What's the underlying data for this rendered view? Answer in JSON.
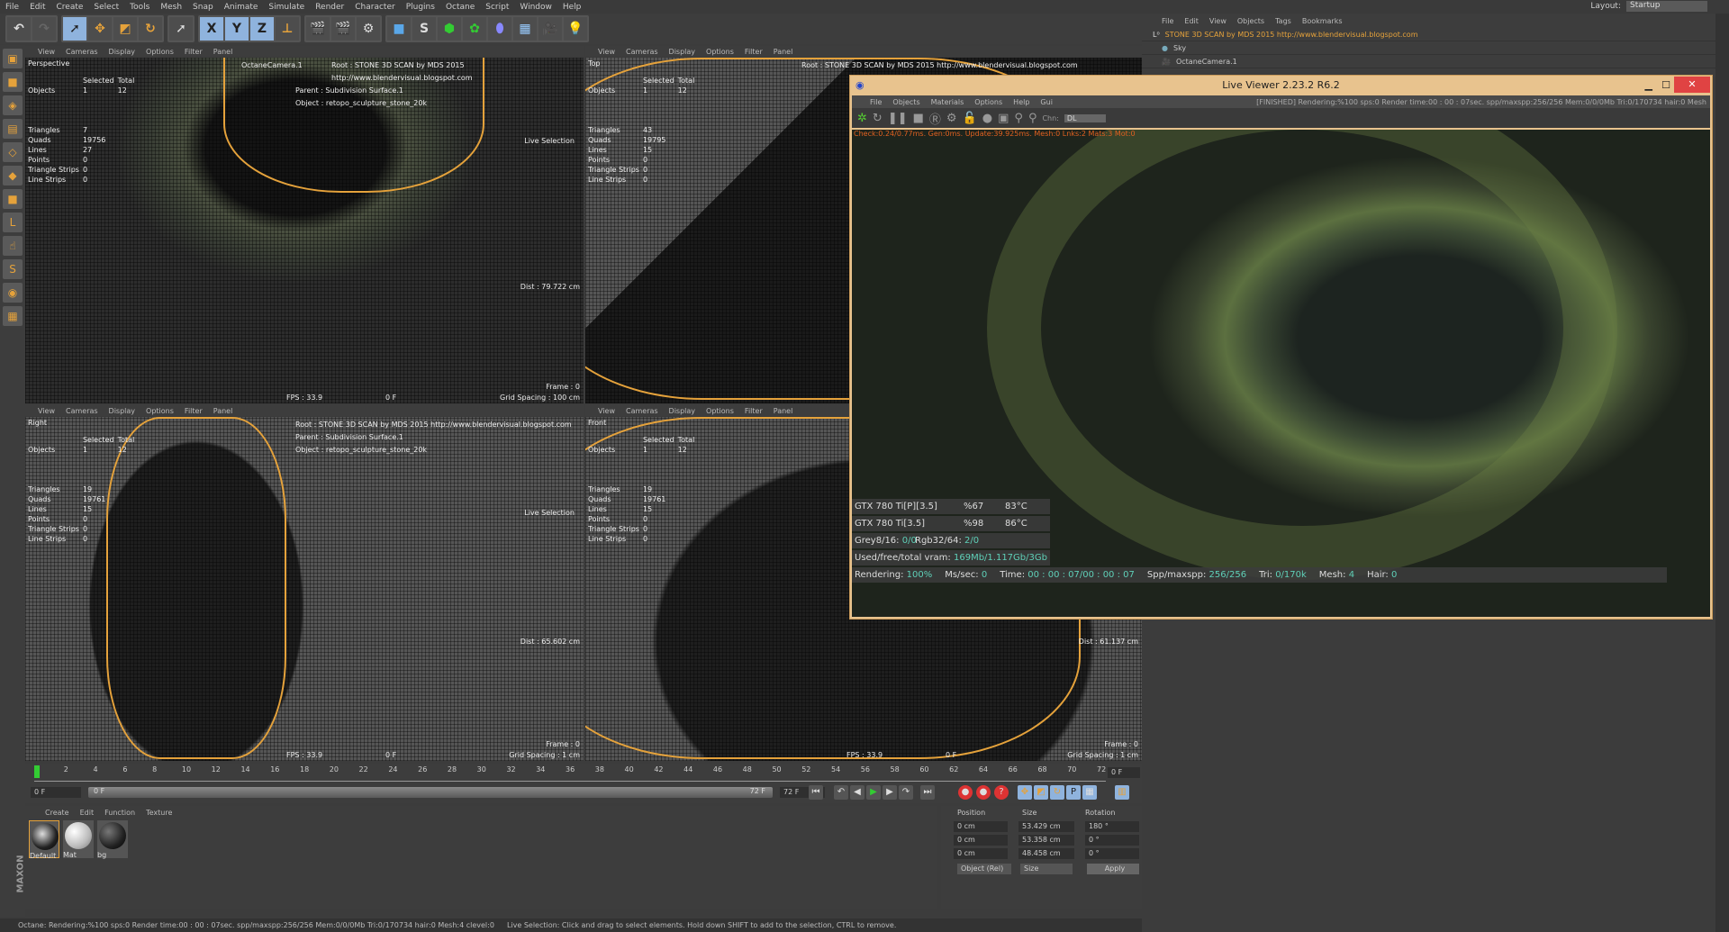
{
  "menu": [
    "File",
    "Edit",
    "Create",
    "Select",
    "Tools",
    "Mesh",
    "Snap",
    "Animate",
    "Simulate",
    "Render",
    "Character",
    "Plugins",
    "Octane",
    "Script",
    "Window",
    "Help"
  ],
  "layout": {
    "label": "Layout:",
    "value": "Startup"
  },
  "viewport_menu": [
    "View",
    "Cameras",
    "Display",
    "Options",
    "Filter",
    "Panel"
  ],
  "info": {
    "root": "Root : STONE 3D SCAN by MDS 2015 http://www.blendervisual.blogspot.com",
    "parent": "Parent : Subdivision Surface.1",
    "object": "Object : retopo_sculpture_stone_20k",
    "camera": "OctaneCamera.1"
  },
  "hud_headers": {
    "selected": "Selected",
    "total": "Total",
    "objects": "Objects",
    "triangles": "Triangles",
    "quads": "Quads",
    "lines": "Lines",
    "points": "Points",
    "tri_strips": "Triangle Strips",
    "line_strips": "Line Strips"
  },
  "viewports": [
    {
      "name": "Perspective",
      "obj_sel": "1",
      "obj_total": "12",
      "triangles": "7",
      "quads": "19756",
      "lines": "27",
      "points": "0",
      "tri_strips": "0",
      "line_strips": "0",
      "dist": "Dist : 79.722 cm",
      "fps": "FPS : 33.9",
      "frame_f": "0 F",
      "frame": "Frame : 0",
      "grid": "Grid Spacing : 100 cm",
      "tool": "Live Selection"
    },
    {
      "name": "Top",
      "obj_sel": "1",
      "obj_total": "12",
      "triangles": "43",
      "quads": "19795",
      "lines": "15",
      "points": "0",
      "tri_strips": "0",
      "line_strips": "0"
    },
    {
      "name": "Right",
      "obj_sel": "1",
      "obj_total": "12",
      "triangles": "19",
      "quads": "19761",
      "lines": "15",
      "points": "0",
      "tri_strips": "0",
      "line_strips": "0",
      "dist": "Dist : 65.602 cm",
      "fps": "FPS : 33.9",
      "frame_f": "0 F",
      "frame": "Frame : 0",
      "grid": "Grid Spacing : 1 cm",
      "tool": "Live Selection"
    },
    {
      "name": "Front",
      "obj_sel": "1",
      "obj_total": "12",
      "triangles": "19",
      "quads": "19761",
      "lines": "15",
      "points": "0",
      "tri_strips": "0",
      "line_strips": "0",
      "dist": "Dist : 61.137 cm",
      "fps": "FPS : 33.9",
      "frame_f": "0 F",
      "frame": "Frame : 0",
      "grid": "Grid Spacing : 1 cm"
    }
  ],
  "timeline": {
    "ticks": [
      "0",
      "2",
      "4",
      "6",
      "8",
      "10",
      "12",
      "14",
      "16",
      "18",
      "20",
      "22",
      "24",
      "26",
      "28",
      "30",
      "32",
      "34",
      "36",
      "38",
      "40",
      "42",
      "44",
      "46",
      "48",
      "50",
      "52",
      "54",
      "56",
      "58",
      "60",
      "62",
      "64",
      "66",
      "68",
      "70",
      "72"
    ],
    "end_field": "0 F",
    "start": "0 F",
    "range_start": "0 F",
    "range_end": "72 F",
    "end": "72 F"
  },
  "materials": {
    "menu": [
      "Create",
      "Edit",
      "Function",
      "Texture"
    ],
    "items": [
      "Default",
      "Mat",
      "bg"
    ]
  },
  "attributes": {
    "position": "Position",
    "size": "Size",
    "rotation": "Rotation",
    "px": "0 cm",
    "py": "0 cm",
    "pz": "0 cm",
    "sx": "53.429 cm",
    "sy": "53.358 cm",
    "sz": "48.458 cm",
    "rh": "180 °",
    "rp": "0 °",
    "rb": "0 °",
    "mode": "Object (Rel)",
    "size_mode": "Size",
    "apply": "Apply"
  },
  "status": {
    "octane": "Octane: Rendering:%100 sps:0 Render time:00 : 00 : 07sec. spp/maxspp:256/256 Mem:0/0/0Mb Tri:0/170734 hair:0 Mesh:4 clevel:0",
    "hint": "Live Selection: Click and drag to select elements. Hold down SHIFT to add to the selection, CTRL to remove."
  },
  "object_manager": {
    "menu": [
      "File",
      "Edit",
      "View",
      "Objects",
      "Tags",
      "Bookmarks"
    ],
    "objects": [
      "STONE 3D SCAN by MDS 2015 http://www.blendervisual.blogspot.com",
      "Sky",
      "OctaneCamera.1"
    ]
  },
  "live_viewer": {
    "title": "Live Viewer 2.23.2 R6.2",
    "menu": [
      "File",
      "Objects",
      "Materials",
      "Options",
      "Help",
      "Gui"
    ],
    "status": "[FINISHED]  Rendering:%100 sps:0 Render time:00 : 00 : 07sec. spp/maxspp:256/256 Mem:0/0/0Mb Tri:0/170734 hair:0 Mesh",
    "chn_label": "Chn:",
    "chn_value": "DL",
    "check": "Check:0.24/0.77ms. Gen:0ms. Update:39.925ms. Mesh:0 Lnks:2 Mats:3 Mot:0",
    "gpus": [
      {
        "name": "GTX 780 Ti[P][3.5]",
        "load": "%67",
        "temp": "83°C"
      },
      {
        "name": "GTX 780 Ti[3.5]",
        "load": "%98",
        "temp": "86°C"
      }
    ],
    "grey_label": "Grey8/16:",
    "grey": "0/0",
    "rgb_label": "Rgb32/64:",
    "rgb": "2/0",
    "vram_label": "Used/free/total vram:",
    "vram": "169Mb/1.117Gb/3Gb",
    "rendering_label": "Rendering:",
    "rendering": "100%",
    "ms_label": "Ms/sec:",
    "ms": "0",
    "time_label": "Time:",
    "time": "00 : 00 : 07/00 : 00 : 07",
    "spp_label": "Spp/maxspp:",
    "spp": "256/256",
    "tri_label": "Tri:",
    "tri": "0/170k",
    "mesh_label": "Mesh:",
    "mesh": "4",
    "hair_label": "Hair:",
    "hair": "0"
  },
  "colors": {
    "accent": "#e5a23b",
    "teal": "#5fd0b8",
    "close": "#e04343"
  }
}
